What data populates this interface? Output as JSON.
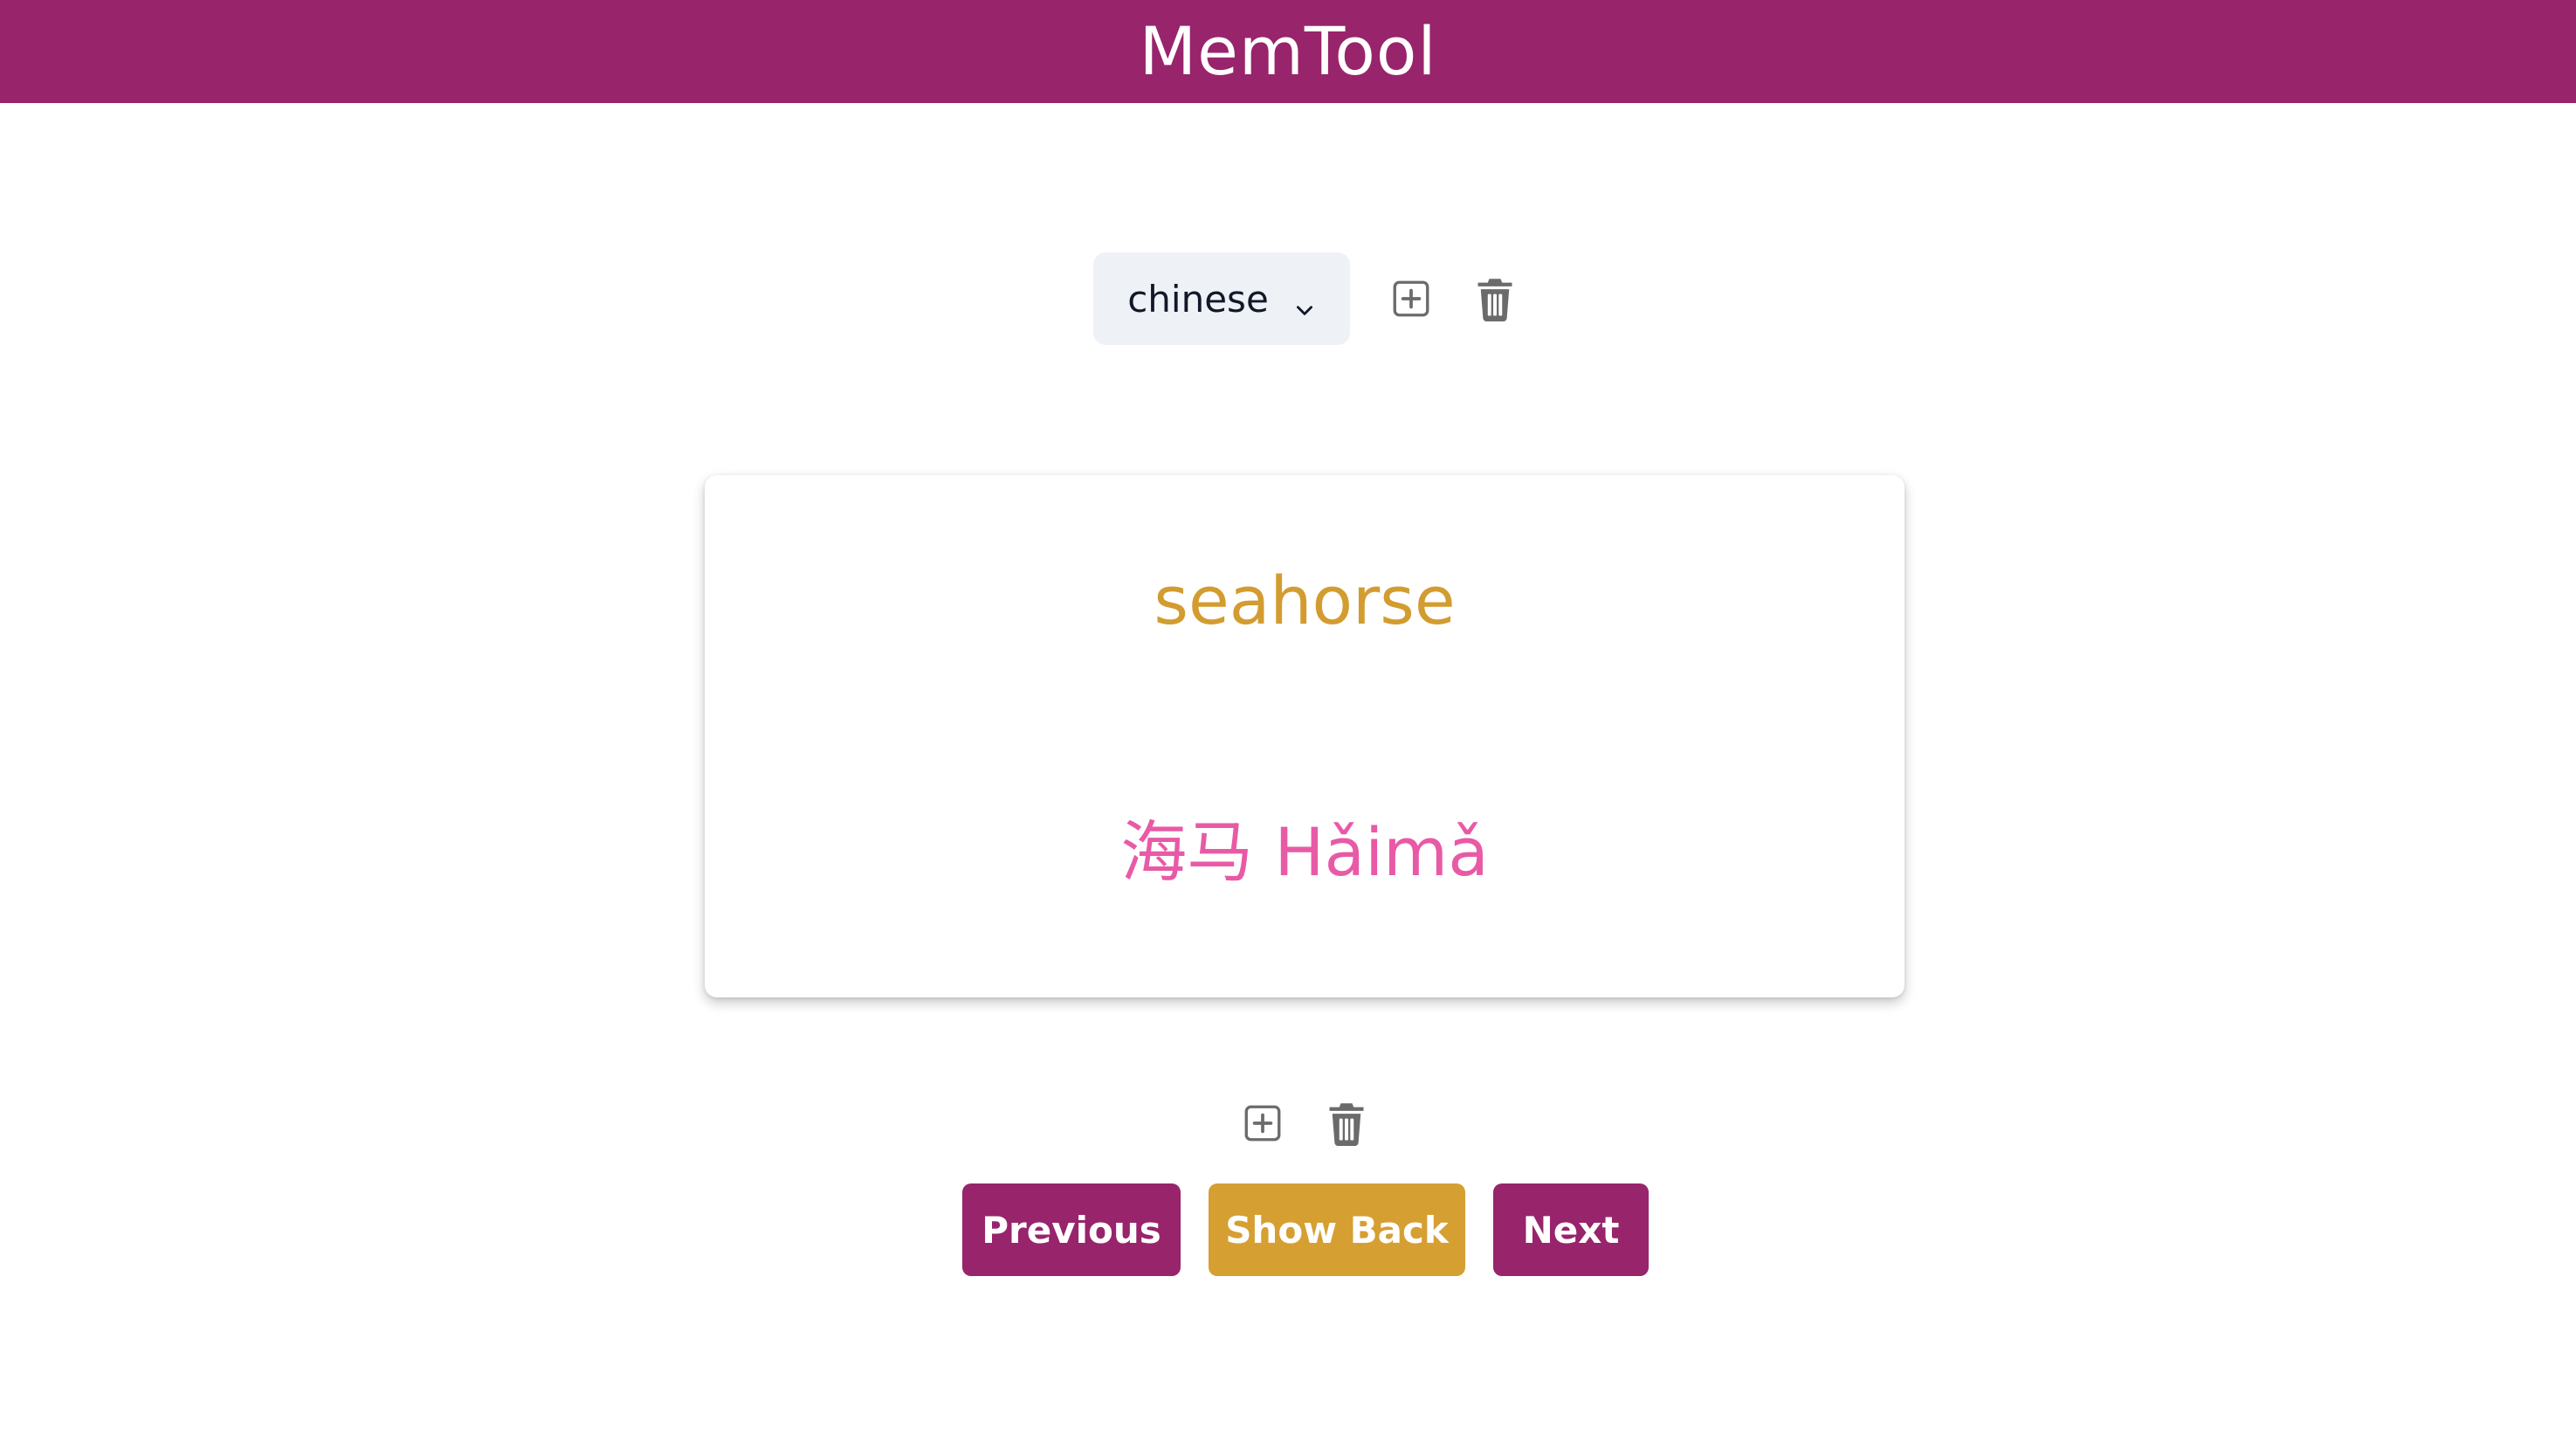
{
  "header": {
    "title": "MemTool"
  },
  "deck": {
    "selected": "chinese",
    "add_icon": "plus-square-icon",
    "delete_icon": "trash-icon"
  },
  "card": {
    "front": "seahorse",
    "back": "海马 Hǎimǎ"
  },
  "card_tools": {
    "add_icon": "plus-square-icon",
    "delete_icon": "trash-icon"
  },
  "nav": {
    "previous_label": "Previous",
    "show_back_label": "Show Back",
    "next_label": "Next"
  },
  "colors": {
    "brand": "#98246c",
    "accent": "#d69f32",
    "front_text": "#d39c30",
    "back_text": "#e85aa6",
    "icon": "#6b6b6b"
  }
}
